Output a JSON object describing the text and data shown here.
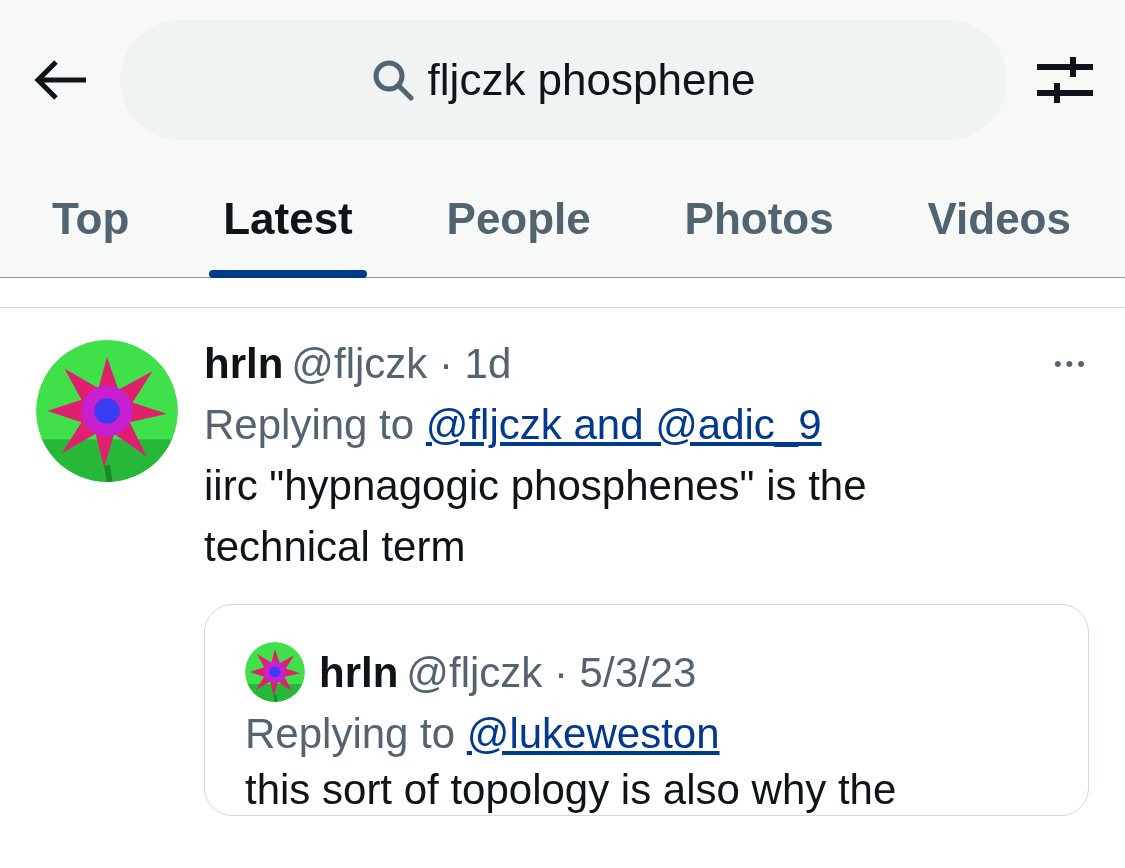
{
  "search": {
    "value": "fljczk phosphene"
  },
  "tabs": [
    {
      "label": "Top",
      "selected": false
    },
    {
      "label": "Latest",
      "selected": true
    },
    {
      "label": "People",
      "selected": false
    },
    {
      "label": "Photos",
      "selected": false
    },
    {
      "label": "Videos",
      "selected": false
    }
  ],
  "tweet": {
    "name": "hrln",
    "handle": "@fljczk",
    "separator": "·",
    "time": "1d",
    "more": "•••",
    "replying_prefix": "Replying to",
    "replying_link": "@fljczk and @adic_9",
    "text": "iirc \"hypnagogic phosphenes\" is the technical term",
    "quote": {
      "name": "hrln",
      "handle": "@fljczk",
      "separator": "·",
      "time": "5/3/23",
      "replying_prefix": "Replying to",
      "replying_link": "@lukeweston",
      "text": "this sort of topology is also why the"
    }
  }
}
